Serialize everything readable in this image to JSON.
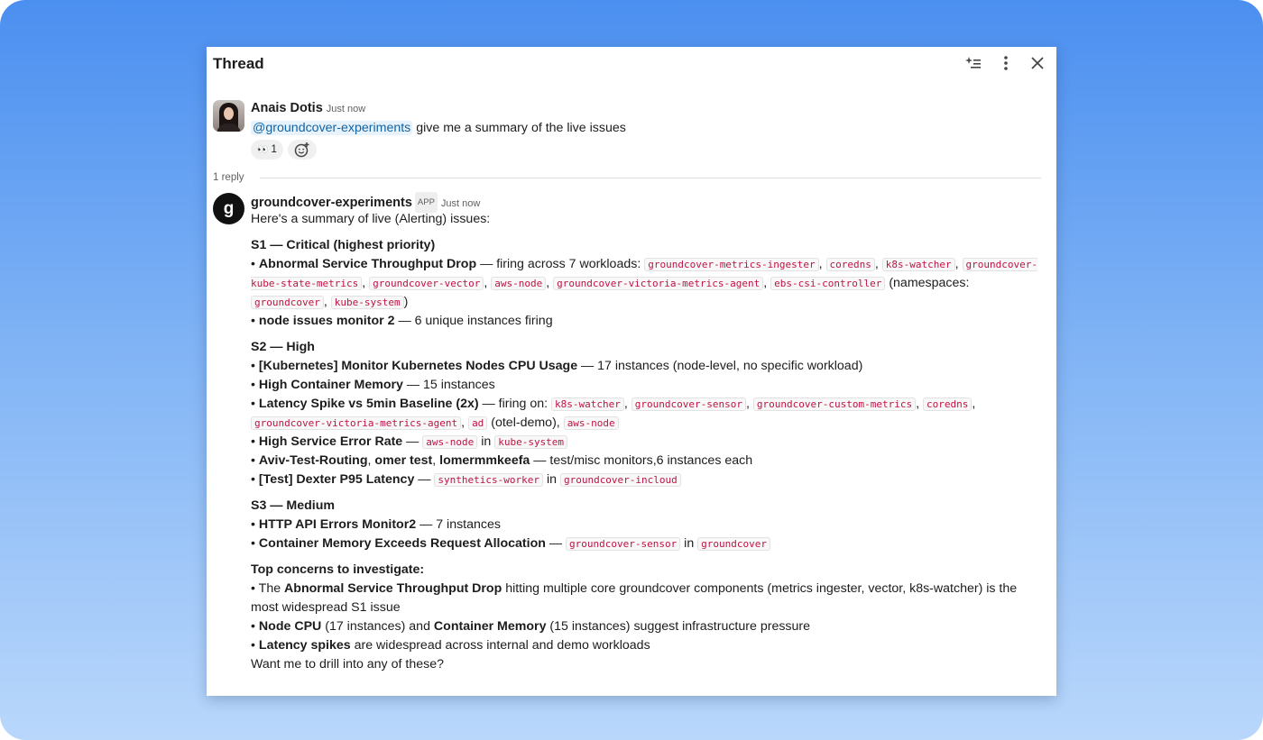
{
  "header": {
    "title": "Thread"
  },
  "root": {
    "author": "Anais Dotis",
    "timestamp": "Just now",
    "mention": "@groundcover-experiments",
    "text": " give me a summary of the live issues",
    "reaction": {
      "emoji": "👀",
      "count": "1"
    }
  },
  "replies": {
    "count_label": "1 reply"
  },
  "reply": {
    "author": "groundcover-experiments",
    "badge": "APP",
    "timestamp": "Just now",
    "avatar_letter": "g",
    "intro": "Here's a summary of live (Alerting) issues:",
    "s1": {
      "heading": "S1 — Critical (highest priority)",
      "a_title": "Abnormal Service Throughput Drop",
      "a_text": " — firing across 7 workloads: ",
      "a_codes": [
        "groundcover-metrics-ingester",
        "coredns",
        "k8s-watcher",
        "groundcover-kube-state-metrics",
        "groundcover-vector",
        "aws-node",
        "groundcover-victoria-metrics-agent",
        "ebs-csi-controller",
        "groundcover",
        "kube-system"
      ],
      "a_ns": " (namespaces: ",
      "b_title": "node issues monitor 2",
      "b_text": " — 6 unique instances firing"
    },
    "s2": {
      "heading": "S2 — High",
      "a_title": "[Kubernetes] Monitor Kubernetes Nodes CPU Usage",
      "a_text": " — 17 instances (node-level, no specific workload)",
      "b_title": "High Container Memory",
      "b_text": " — 15 instances",
      "c_title": "Latency Spike vs 5min Baseline (2x)",
      "c_text": " — firing on: ",
      "c_codes": [
        "k8s-watcher",
        "groundcover-sensor",
        "groundcover-custom-metrics",
        "coredns",
        "groundcover-victoria-metrics-agent",
        "ad",
        "aws-node"
      ],
      "c_otel": " (otel-demo), ",
      "d_title": "High Service Error Rate",
      "d_code1": "aws-node",
      "d_code2": "kube-system",
      "e_t1": "Aviv-Test-Routing",
      "e_t2": "omer test",
      "e_t3": "lomermmkeefa",
      "e_text": " — test/misc monitors,6 instances each",
      "f_title": "[Test] Dexter P95 Latency",
      "f_code1": "synthetics-worker",
      "f_code2": "groundcover-incloud"
    },
    "s3": {
      "heading": "S3 — Medium",
      "a_title": "HTTP API Errors Monitor2",
      "a_text": " — 7 instances",
      "b_title": "Container Memory Exceeds Request Allocation",
      "b_code1": "groundcover-sensor",
      "b_code2": "groundcover"
    },
    "concerns": {
      "heading": "Top concerns to investigate:",
      "a_pre": "The ",
      "a_title": "Abnormal Service Throughput Drop",
      "a_text": " hitting multiple core groundcover components (metrics ingester, vector, k8s-watcher) is the most widespread S1 issue",
      "b_t1": "Node CPU",
      "b_mid": " (17 instances) and ",
      "b_t2": "Container Memory",
      "b_text": " (15 instances) suggest infrastructure pressure",
      "c_title": "Latency spikes",
      "c_text": " are widespread across internal and demo workloads"
    },
    "closing": "Want me to drill into any of these?"
  }
}
